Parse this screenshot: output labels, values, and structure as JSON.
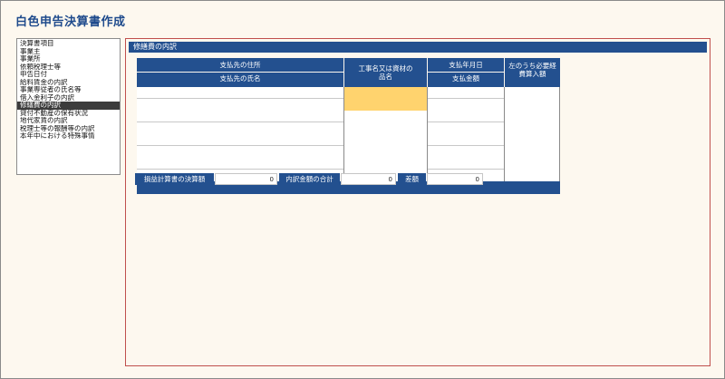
{
  "app": {
    "title": "白色申告決算書作成"
  },
  "nav": {
    "items": [
      {
        "label": "決算書項目",
        "selected": false
      },
      {
        "label": "事業主",
        "selected": false
      },
      {
        "label": "事業所",
        "selected": false
      },
      {
        "label": "依頼税理士等",
        "selected": false
      },
      {
        "label": "申告日付",
        "selected": false
      },
      {
        "label": "給料賃金の内訳",
        "selected": false
      },
      {
        "label": "事業専従者の氏名等",
        "selected": false
      },
      {
        "label": "借入金利子の内訳",
        "selected": false
      },
      {
        "label": "修繕費の内訳",
        "selected": true
      },
      {
        "label": "貸付不動産の保有状況",
        "selected": false
      },
      {
        "label": "地代家賃の内訳",
        "selected": false
      },
      {
        "label": "税理士等の報酬等の内訳",
        "selected": false
      },
      {
        "label": "本年中における特殊事情",
        "selected": false
      }
    ]
  },
  "panel": {
    "header": "修繕費の内訳",
    "columns": {
      "payee_address": "支払先の住所",
      "payee_name": "支払先の氏名",
      "work_item": "工事名又は資材の品名",
      "payment_date": "支払年月日",
      "payment_amount": "支払金額",
      "necessary_expense": "左のうち必要経費算入額"
    },
    "summary": {
      "statement_label": "損益計算書の決算額",
      "statement_value": "0",
      "breakdown_label": "内訳金額の合計",
      "breakdown_value": "0",
      "diff_label": "差額",
      "diff_value": "0"
    }
  },
  "colors": {
    "header_blue": "#23508f",
    "title_blue": "#1e4a8c",
    "highlight": "#ffd36e",
    "panel_border": "#c0504d",
    "background": "#fdf8ef"
  }
}
